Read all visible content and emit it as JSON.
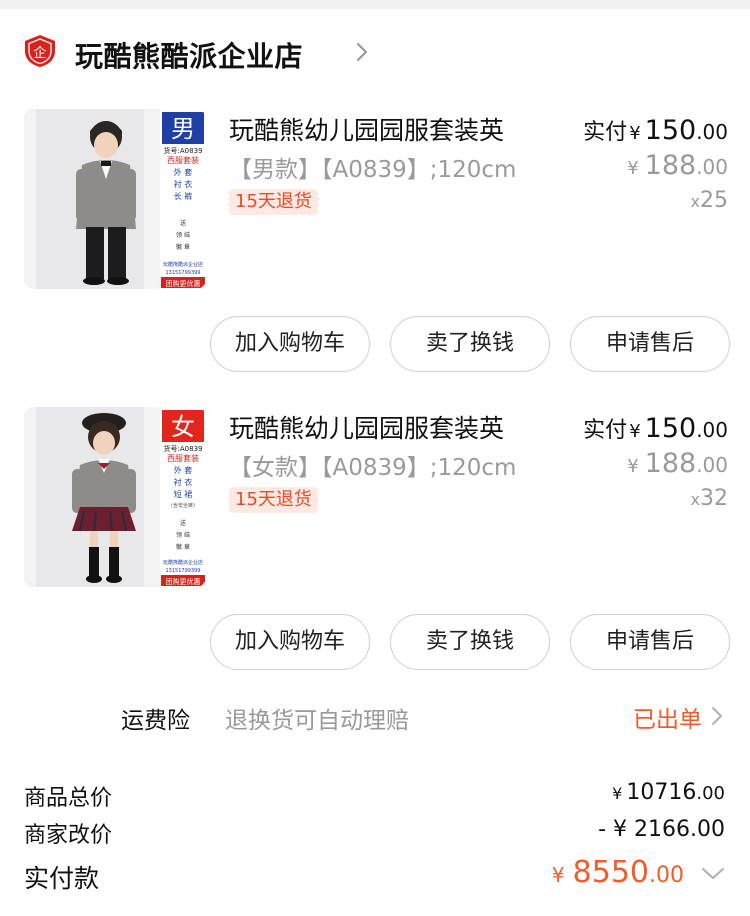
{
  "store": {
    "name": "玩酷熊酷派企业店",
    "badge_glyph": "企",
    "badge_color": "#d8231c",
    "icon": "store-badge-icon"
  },
  "items": [
    {
      "title": "玩酷熊幼儿园园服套装英",
      "sku": "【男款】【A0839】;120cm",
      "return_tag": "15天退货",
      "paid_label": "实付",
      "currency": "¥",
      "paid_int": "150",
      "paid_dec": ".00",
      "orig_int": "188",
      "orig_dec": ".00",
      "qty_x": "x",
      "qty": "25",
      "thumb": {
        "gender_char": "男",
        "gender_color": "#1f3fa7",
        "lines": [
          "货号:A0839",
          "西服套装",
          "外 套",
          "衬 衣",
          "长 裤",
          "送",
          "领 结",
          "徽 章",
          "玩酷熊酷派企业店",
          "13151799399",
          "团购更优惠"
        ]
      },
      "buttons": [
        "加入购物车",
        "卖了换钱",
        "申请售后"
      ]
    },
    {
      "title": "玩酷熊幼儿园园服套装英",
      "sku": "【女款】【A0839】;120cm",
      "return_tag": "15天退货",
      "paid_label": "实付",
      "currency": "¥",
      "paid_int": "150",
      "paid_dec": ".00",
      "orig_int": "188",
      "orig_dec": ".00",
      "qty_x": "x",
      "qty": "32",
      "thumb": {
        "gender_char": "女",
        "gender_color": "#e0261d",
        "lines": [
          "货号:A0839",
          "西服套装",
          "外 套",
          "衬 衣",
          "短 裙",
          "(含安全裤)",
          "送",
          "领 结",
          "徽 章",
          "玩酷熊酷派企业店",
          "13151799399",
          "团购更优惠"
        ]
      },
      "buttons": [
        "加入购物车",
        "卖了换钱",
        "申请售后"
      ]
    }
  ],
  "insurance": {
    "label": "运费险",
    "desc": "退换货可自动理赔",
    "status": "已出单",
    "status_color": "#f25c2a"
  },
  "summary": {
    "goods_total_label": "商品总价",
    "goods_total_currency": "¥",
    "goods_total_int": "10716",
    "goods_total_dec": ".00",
    "adjust_label": "商家改价",
    "adjust_value": "- ¥ 2166.00",
    "paid_label": "实付款",
    "paid_currency": "¥",
    "paid_int": "8550",
    "paid_dec": ".00",
    "accent": "#f25c2a"
  }
}
